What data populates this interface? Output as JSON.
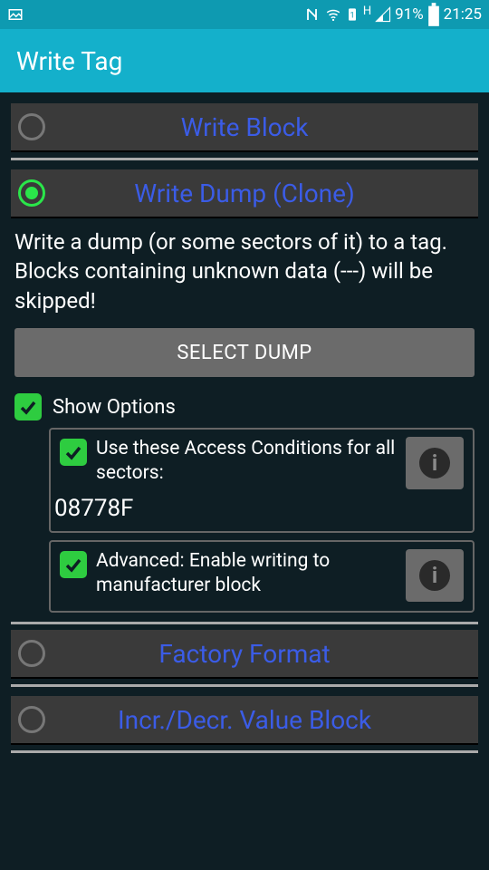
{
  "status": {
    "battery_pct": "91%",
    "time": "21:25",
    "net_label": "H"
  },
  "appbar": {
    "title": "Write Tag"
  },
  "radios": {
    "write_block": "Write Block",
    "write_dump": "Write Dump (Clone)",
    "factory_format": "Factory Format",
    "value_block": "Incr./Decr. Value Block"
  },
  "dump": {
    "description": "Write a dump (or some sectors of it) to a tag. Blocks containing unknown data (---) will be skipped!",
    "select_btn": "SELECT DUMP",
    "show_options": "Show Options",
    "opt_ac_label": "Use these Access Conditions for all sectors:",
    "opt_ac_value": "08778F",
    "opt_adv_label": "Advanced: Enable writing to manufacturer block"
  }
}
